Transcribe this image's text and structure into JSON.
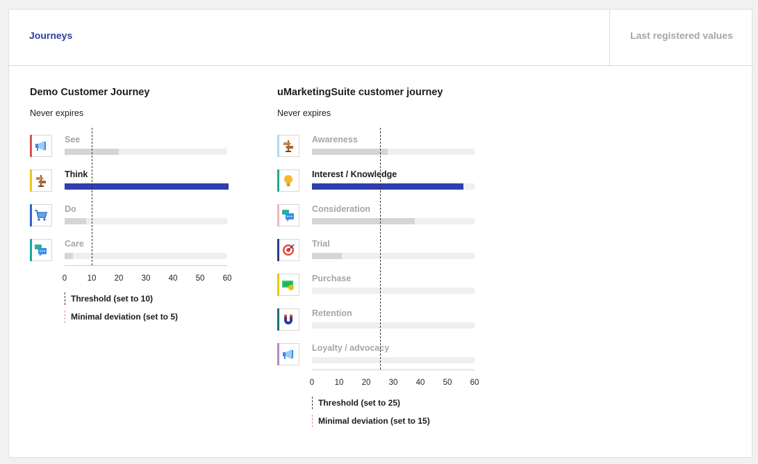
{
  "tabs": {
    "journeys": "Journeys",
    "last_values": "Last registered values"
  },
  "axis_ticks": [
    "0",
    "10",
    "20",
    "30",
    "40",
    "50",
    "60"
  ],
  "journeys": [
    {
      "title": "Demo Customer Journey",
      "expiry": "Never expires",
      "threshold": 10,
      "axis_max": 60,
      "legend_threshold": "Threshold (set to 10)",
      "legend_deviation": "Minimal deviation (set to 5)",
      "stages": [
        {
          "label": "See",
          "value": 20,
          "active": false,
          "icon": "megaphone-icon",
          "accent": "#d9534f"
        },
        {
          "label": "Think",
          "value": 60,
          "active": true,
          "icon": "signpost-icon",
          "accent": "#f0c419"
        },
        {
          "label": "Do",
          "value": 8,
          "active": false,
          "icon": "shopping-cart-icon",
          "accent": "#2d64c8"
        },
        {
          "label": "Care",
          "value": 3,
          "active": false,
          "icon": "chat-bubbles-icon",
          "accent": "#1aa99a"
        }
      ]
    },
    {
      "title": "uMarketingSuite customer journey",
      "expiry": "Never expires",
      "threshold": 25,
      "axis_max": 60,
      "legend_threshold": "Threshold (set to 25)",
      "legend_deviation": "Minimal deviation (set to 15)",
      "stages": [
        {
          "label": "Awareness",
          "value": 28,
          "active": false,
          "icon": "signpost-icon",
          "accent": "#a8dde8"
        },
        {
          "label": "Interest / Knowledge",
          "value": 56,
          "active": true,
          "icon": "lightbulb-icon",
          "accent": "#27a594"
        },
        {
          "label": "Consideration",
          "value": 38,
          "active": false,
          "icon": "chat-bubbles-icon",
          "accent": "#f4b6b8"
        },
        {
          "label": "Trial",
          "value": 11,
          "active": false,
          "icon": "target-icon",
          "accent": "#2e3b8f"
        },
        {
          "label": "Purchase",
          "value": 0,
          "active": false,
          "icon": "money-icon",
          "accent": "#f0c419"
        },
        {
          "label": "Retention",
          "value": 0,
          "active": false,
          "icon": "magnet-icon",
          "accent": "#1f6f78"
        },
        {
          "label": "Loyalty / advocacy",
          "value": 0,
          "active": false,
          "icon": "megaphone-icon",
          "accent": "#b58ac4"
        }
      ]
    }
  ]
}
